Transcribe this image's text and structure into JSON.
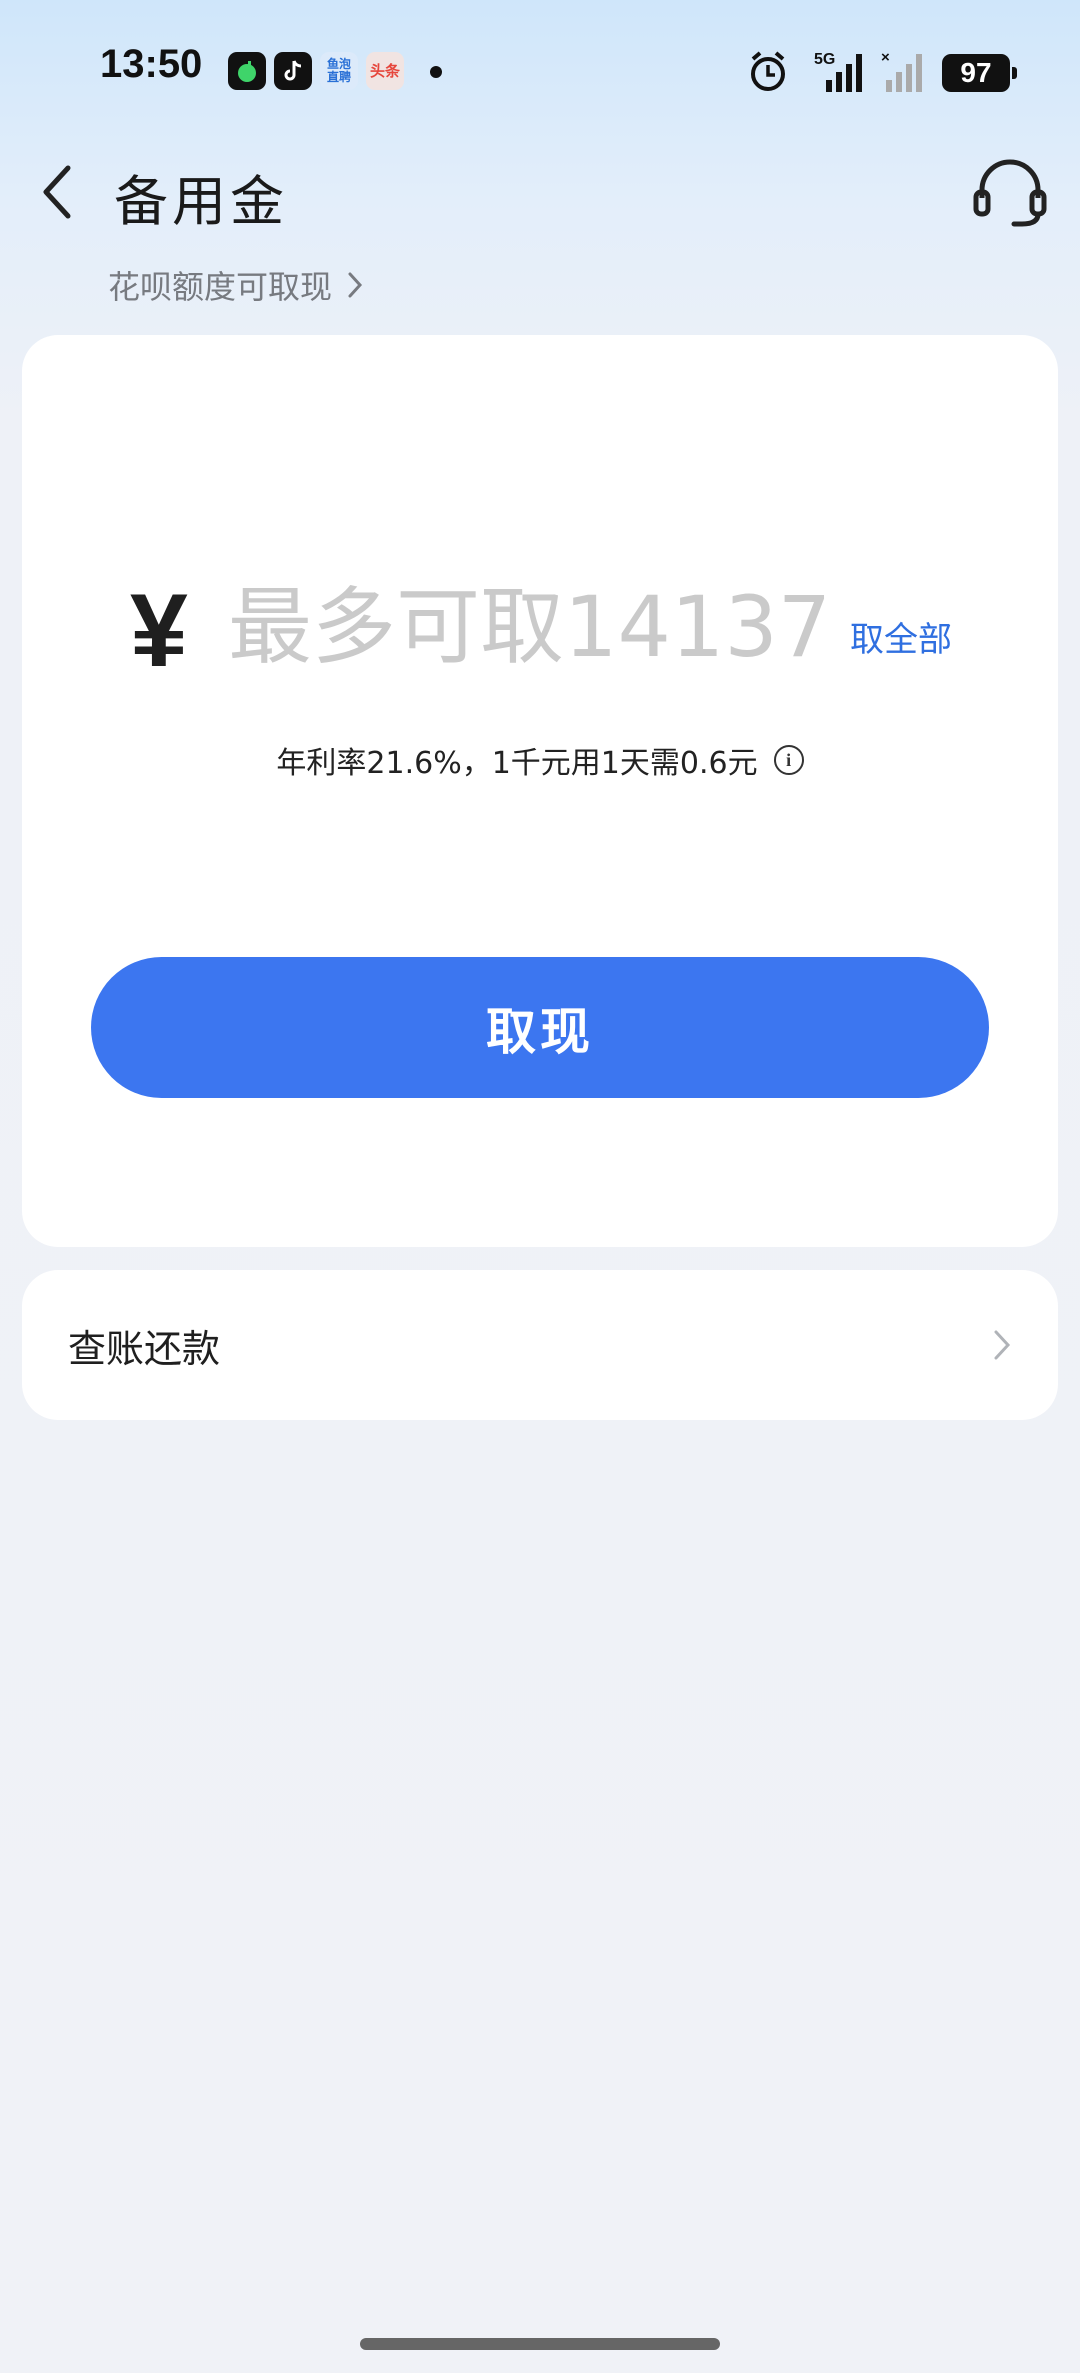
{
  "status_bar": {
    "time": "13:50",
    "apps": [
      {
        "icon": "music-app-icon",
        "label": "",
        "color": "#111111"
      },
      {
        "icon": "tiktok-icon",
        "label": "",
        "color": "#111111"
      },
      {
        "icon": "yupao-app-icon",
        "label": "鱼泡直聘",
        "color": "#3b8ae6"
      },
      {
        "icon": "toutiao-icon",
        "label": "头条",
        "color": "#e6463c"
      }
    ],
    "network": "5G",
    "battery": "97"
  },
  "header": {
    "title": "备用金",
    "subtitle": "花呗额度可取现"
  },
  "withdraw": {
    "currency": "¥",
    "placeholder": "最多可取14137",
    "withdraw_all": "取全部",
    "rate_text": "年利率21.6%，1千元用1天需0.6元",
    "button": "取现"
  },
  "bill": {
    "label": "查账还款"
  },
  "colors": {
    "primary": "#3c76f0",
    "link": "#2f6fe0",
    "background": "#f0f2f7"
  }
}
